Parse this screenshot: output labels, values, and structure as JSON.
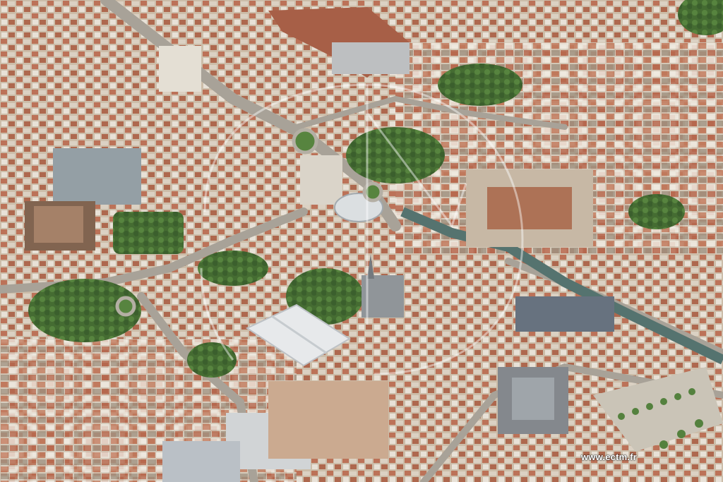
{
  "photo": {
    "subject": "aerial-city-view",
    "watermark_text": "www.ectm.fr",
    "colors": {
      "roof_terracotta": "#b86a4e",
      "roof_light": "#d9cfc0",
      "vegetation": "#3f6b2a",
      "street": "#9a958a",
      "water": "#4b6b66"
    }
  }
}
